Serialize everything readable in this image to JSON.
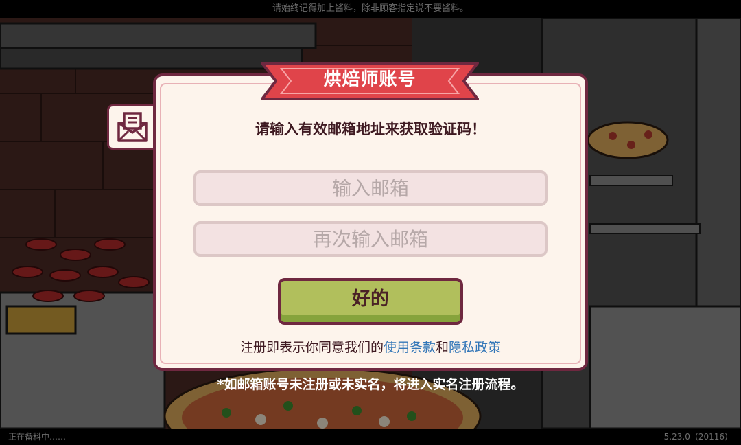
{
  "top_hint": "请始终记得加上酱料，除非顾客指定说不要酱料。",
  "dialog": {
    "title": "烘焙师账号",
    "prompt": "请输入有效邮箱地址来获取验证码！",
    "email_placeholder": "输入邮箱",
    "email_confirm_placeholder": "再次输入邮箱",
    "ok_label": "好的",
    "terms_prefix": "注册即表示你同意我们的",
    "terms_link": "使用条款",
    "terms_and": "和",
    "privacy_link": "隐私政策"
  },
  "footnote": "*如邮箱账号未注册或未实名，将进入实名注册流程。",
  "status_text": "正在备料中……",
  "version": "5.23.0（20116）",
  "side_tab": {
    "icon": "mail-icon"
  },
  "colors": {
    "ribbon": "#e0444a",
    "dialog_bg": "#fdf4ec",
    "border": "#6f2840",
    "button": "#b1bf5c",
    "link": "#3477b8"
  }
}
